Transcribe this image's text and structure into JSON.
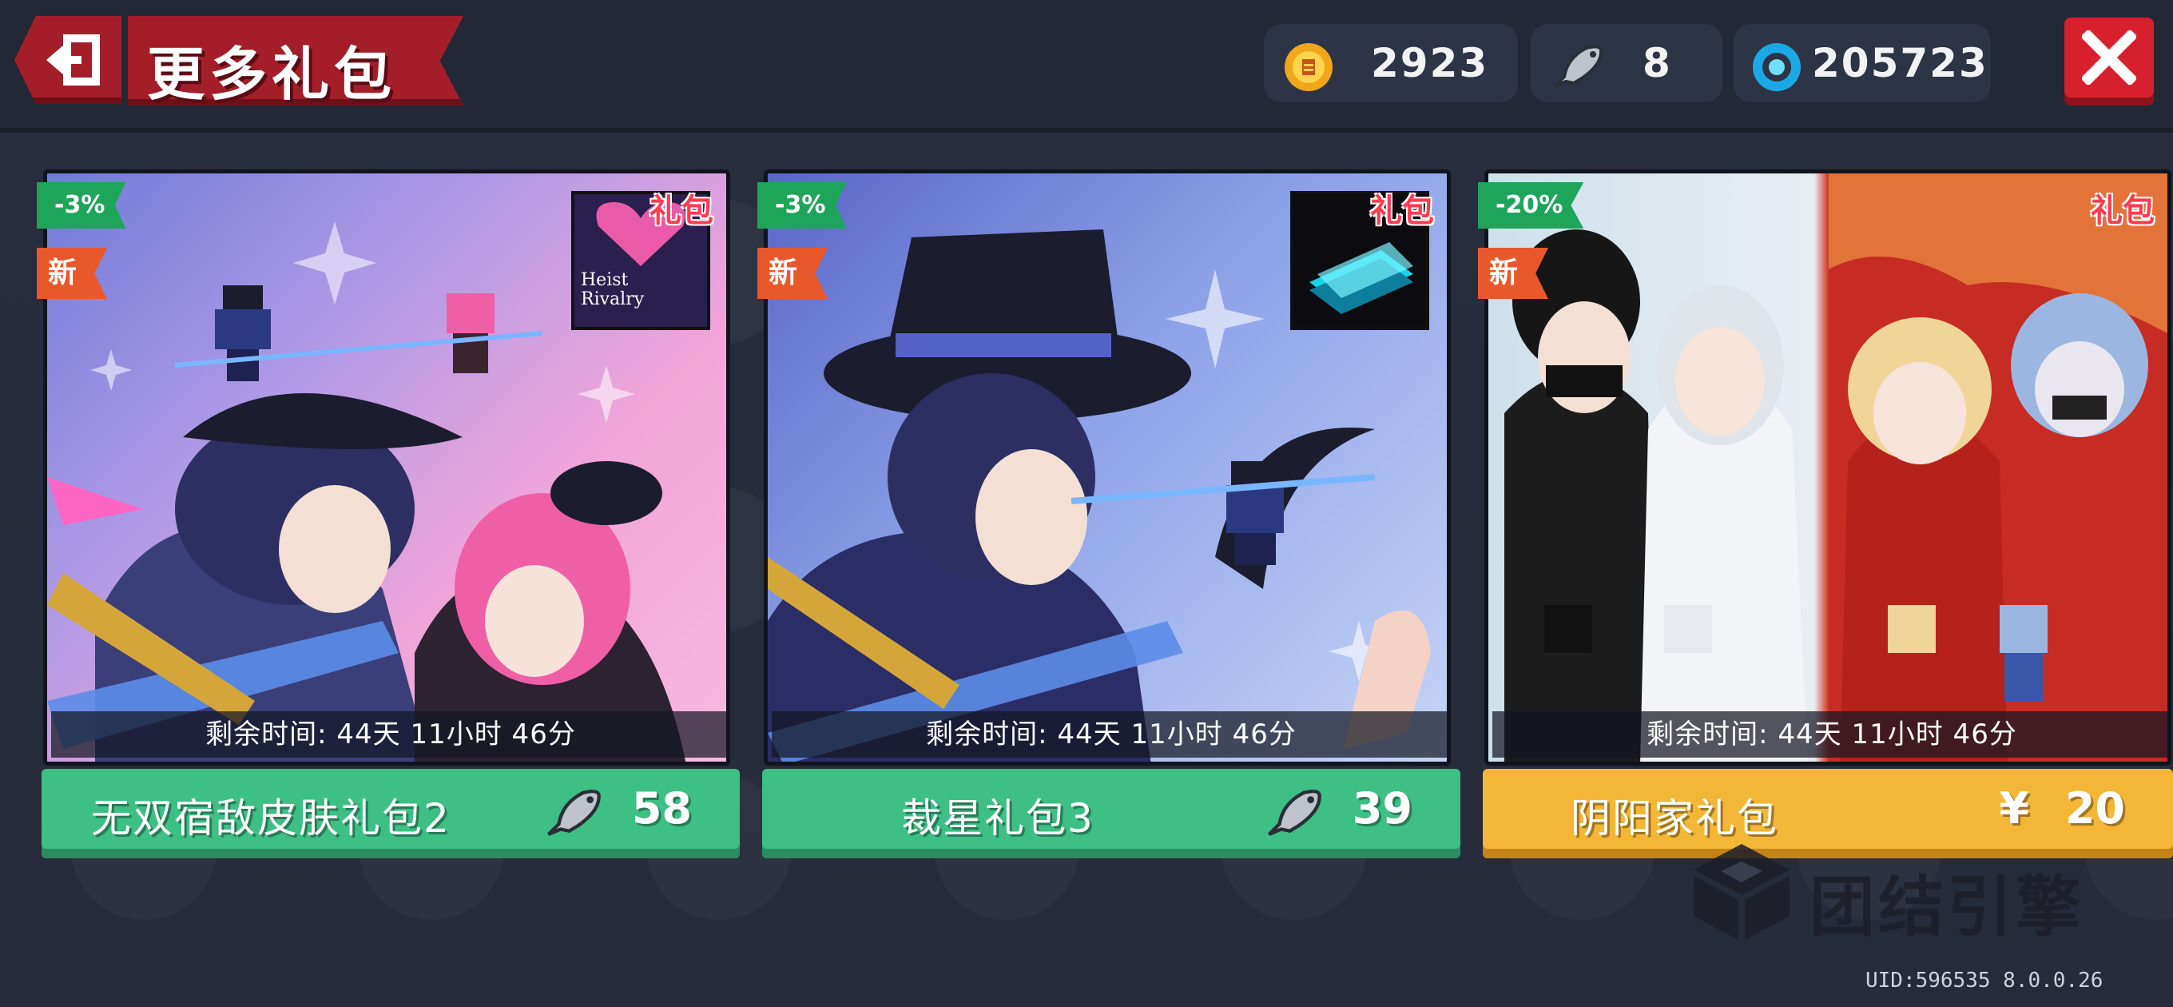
{
  "header": {
    "title": "更多礼包",
    "back_icon": "exit-icon",
    "close_icon": "close-icon"
  },
  "currencies": [
    {
      "icon": "gold-coin-icon",
      "value": "2923"
    },
    {
      "icon": "fish-icon",
      "value": "8"
    },
    {
      "icon": "gem-icon",
      "value": "205723"
    }
  ],
  "packs": [
    {
      "discount": "-3%",
      "new_label": "新",
      "tag": "礼包",
      "album_text": "Heist\nRivalry",
      "timer": "剩余时间: 44天 11小时 46分",
      "name": "无双宿敌皮肤礼包2",
      "price_icon": "fish-icon",
      "price": "58"
    },
    {
      "discount": "-3%",
      "new_label": "新",
      "tag": "礼包",
      "timer": "剩余时间: 44天 11小时 46分",
      "name": "裁星礼包3",
      "price_icon": "fish-icon",
      "price": "39"
    },
    {
      "discount": "-20%",
      "new_label": "新",
      "tag": "礼包",
      "timer": "剩余时间: 44天 11小时 46分",
      "name": "阴阳家礼包",
      "currency_symbol": "¥",
      "price": "20"
    }
  ],
  "watermark": "团结引擎",
  "uid": "UID:596535 8.0.0.26",
  "colors": {
    "accent_red": "#a41e2a",
    "buy_green": "#3dbf86",
    "buy_gold": "#f3b636",
    "discount_green": "#1fa55a",
    "new_orange": "#e9582b"
  }
}
